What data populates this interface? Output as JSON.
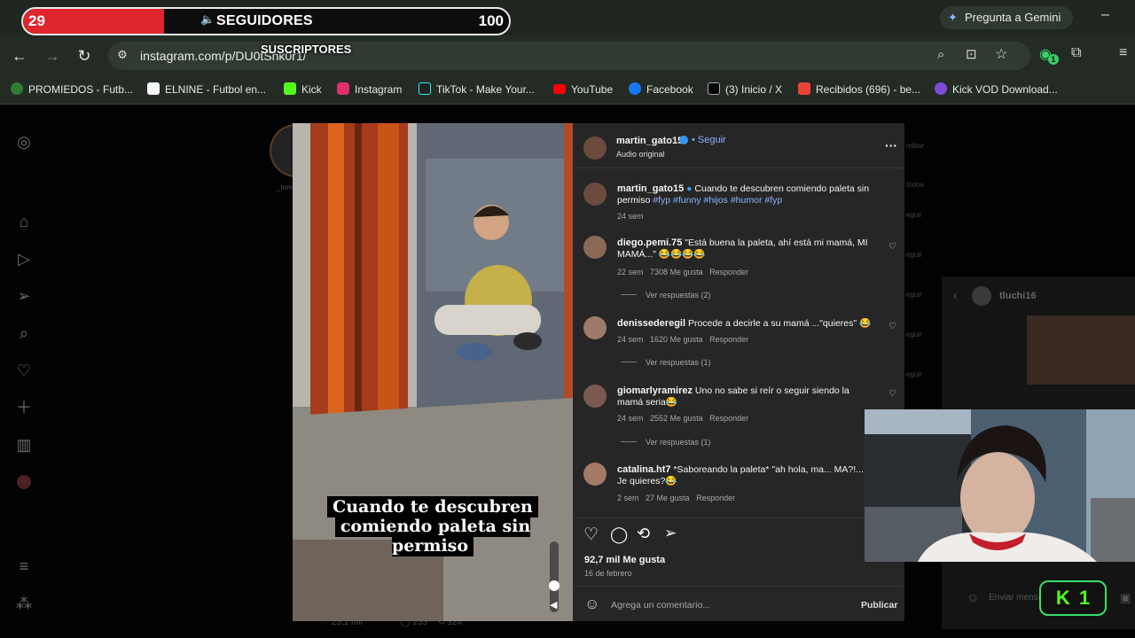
{
  "overlay": {
    "count": "29",
    "label": "SEGUIDORES",
    "goal": "100",
    "progress": 0.29,
    "subtitle": "SUSCRIPTORES"
  },
  "browser": {
    "url": "instagram.com/p/DU0tSnk0r1/",
    "gemini_label": "Pregunta a Gemini",
    "extension_badge": "1",
    "bookmarks": [
      {
        "label": "PROMIEDOS - Futb...",
        "icon": "promiedos-icon",
        "color": "#2e7d32"
      },
      {
        "label": "ELNINE - Futbol en...",
        "icon": "elnine-icon",
        "color": "#111111"
      },
      {
        "label": "Kick",
        "icon": "kick-icon",
        "color": "#53fc18"
      },
      {
        "label": "Instagram",
        "icon": "instagram-icon",
        "color": "#e1306c"
      },
      {
        "label": "TikTok - Make Your...",
        "icon": "tiktok-icon",
        "color": "#111111"
      },
      {
        "label": "YouTube",
        "icon": "youtube-icon",
        "color": "#ff0000"
      },
      {
        "label": "Facebook",
        "icon": "facebook-icon",
        "color": "#1877f2"
      },
      {
        "label": "(3) Inicio / X",
        "icon": "x-icon",
        "color": "#000000"
      },
      {
        "label": "Recibidos (696) - be...",
        "icon": "gmail-icon",
        "color": "#ea4335"
      },
      {
        "label": "Kick VOD Download...",
        "icon": "kickvod-icon",
        "color": "#7b4bd6"
      }
    ]
  },
  "post": {
    "author": "martin_gato15",
    "follow": "Seguir",
    "audio": "Audio original",
    "video_caption_line1": "Cuando te descubren",
    "video_caption_line2": "comiendo paleta sin permiso",
    "caption": {
      "user": "martin_gato15",
      "text": "Cuando te descubren comiendo paleta sin permiso",
      "tags": "#fyp #funny #hijos #humor #fyp",
      "time": "24 sem"
    },
    "comments": [
      {
        "user": "diego.pemi.75",
        "text": "\"Está buena la paleta, ahí está mi mamá, MI MAMÁ...\" 😂😂😂😂",
        "time": "22 sem",
        "likes": "7308 Me gusta",
        "reply": "Responder",
        "replies": "Ver respuestas (2)"
      },
      {
        "user": "denissederegil",
        "text": "Procede a decirle a su mamá ...\"quieres\" 😂",
        "time": "24 sem",
        "likes": "1620 Me gusta",
        "reply": "Responder",
        "replies": "Ver respuestas (1)"
      },
      {
        "user": "giomarlyramirez",
        "text": "Uno no sabe si reír o seguir siendo la mamá seria😂",
        "time": "24 sem",
        "likes": "2552 Me gusta",
        "reply": "Responder",
        "replies": "Ver respuestas (1)"
      },
      {
        "user": "catalina.ht7",
        "text": "*Saboreando la paleta* \"ah hola, ma... MA?!... Je quieres?😂",
        "time": "2 sem",
        "likes": "27 Me gusta",
        "reply": "Responder",
        "replies": ""
      }
    ],
    "likes_total": "92,7 mil Me gusta",
    "date": "16 de febrero",
    "comment_placeholder": "Agrega un comentario...",
    "publish": "Publicar"
  },
  "background": {
    "dm_user": "tluchi16",
    "dm_placeholder": "Enviar mensaje...",
    "feed_user": "_tom",
    "stats": [
      "23,1 mil",
      "233",
      "324"
    ],
    "right_labels": [
      "mbiar",
      "todos",
      "eguir",
      "eguir",
      "eguir",
      "eguir",
      "eguir"
    ]
  },
  "kick_badge": "1"
}
